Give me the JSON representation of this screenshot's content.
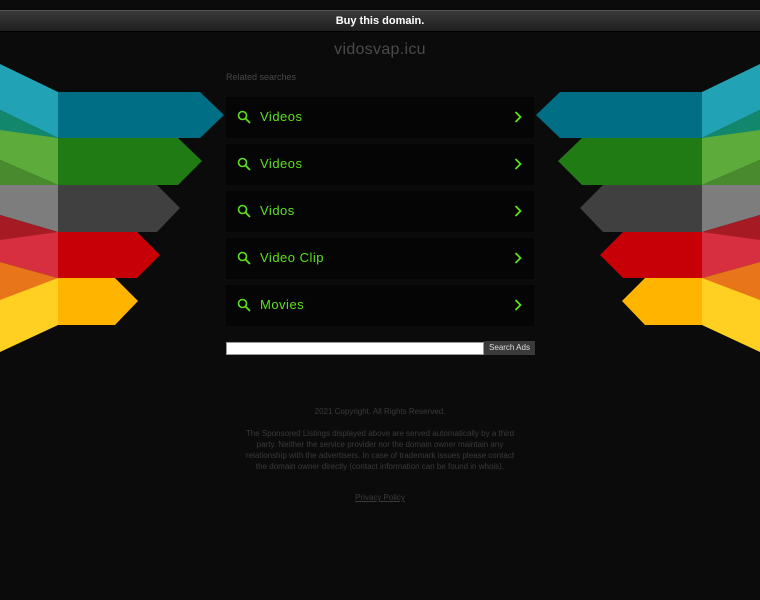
{
  "topbar": {
    "buy_label": "Buy this domain."
  },
  "domain": {
    "name": "vidosvap.icu"
  },
  "related": {
    "title": "Related searches",
    "items": [
      {
        "label": "Videos"
      },
      {
        "label": "Videos"
      },
      {
        "label": "Vidos"
      },
      {
        "label": "Video Clip"
      },
      {
        "label": "Movies"
      }
    ]
  },
  "search": {
    "placeholder": "",
    "button_label": "Search Ads"
  },
  "footer": {
    "copyright": "2021 Copyright. All Rights Reserved.",
    "disclaimer": "The Sponsored Listings displayed above are served automatically by a third party. Neither the service provider nor the domain owner maintain any relationship with the advertisers. In case of trademark issues please contact the domain owner directly (contact information can be found in whois).",
    "privacy_label": "Privacy Policy"
  },
  "colors": {
    "link_green": "#5fe01e",
    "bands": [
      "#21a3b5",
      "#13876b",
      "#5dab3a",
      "#7d7d7d",
      "#a51a23",
      "#e8751a",
      "#ffd021"
    ]
  },
  "icons": {
    "search": "search-icon",
    "chevron": "chevron-right-icon"
  }
}
